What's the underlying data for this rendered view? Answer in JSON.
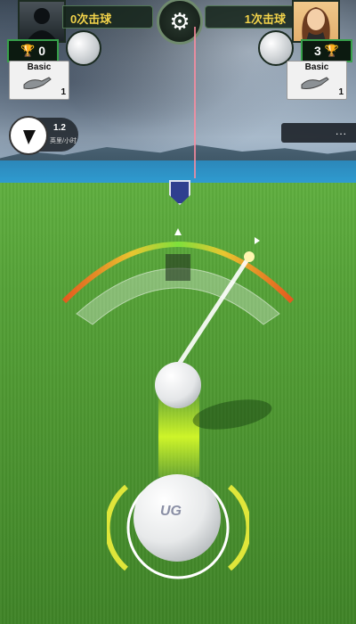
{
  "players": {
    "left": {
      "strokes": "0次击球",
      "score": "0",
      "club": {
        "name": "Basic",
        "level": "1"
      }
    },
    "right": {
      "strokes": "1次击球",
      "score": "3",
      "club": {
        "name": "Basic",
        "level": "1"
      }
    }
  },
  "wind": {
    "speed": "1.2",
    "unit": "英里/小时"
  },
  "side_tab": {
    "label": "..."
  },
  "ball": {
    "brand": "UG"
  },
  "colors": {
    "accent_green": "#37a04a",
    "strokes_yellow": "#f2d34a",
    "meter_green": "#7ee03b",
    "meter_red": "#e35a1e"
  },
  "icons": {
    "settings": "gear-icon",
    "trophy": "trophy-icon",
    "wind": "wind-arrow-icon",
    "shield": "shield-icon"
  }
}
